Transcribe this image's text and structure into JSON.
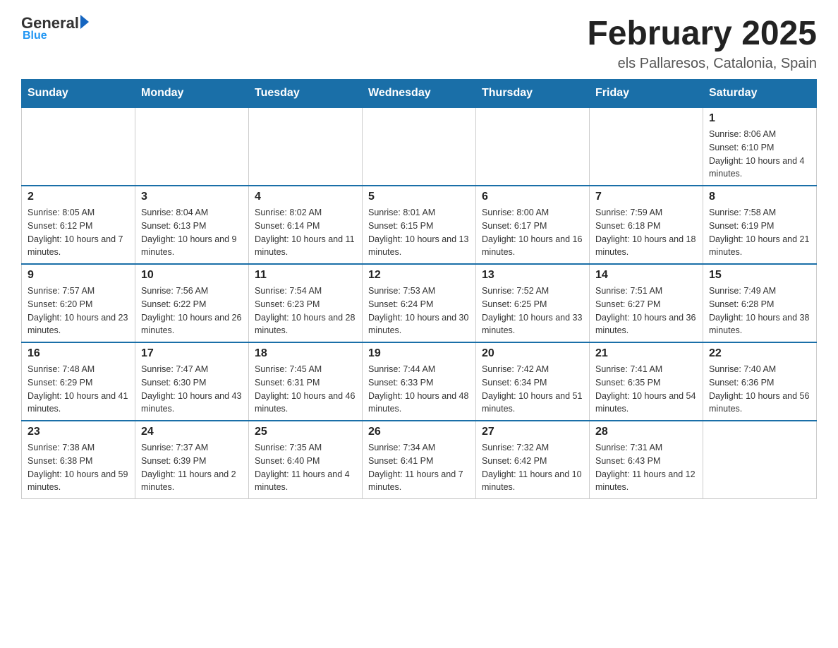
{
  "logo": {
    "text": "General",
    "blue_text": "Blue"
  },
  "title": "February 2025",
  "subtitle": "els Pallaresos, Catalonia, Spain",
  "weekdays": [
    "Sunday",
    "Monday",
    "Tuesday",
    "Wednesday",
    "Thursday",
    "Friday",
    "Saturday"
  ],
  "weeks": [
    [
      {
        "day": "",
        "info": ""
      },
      {
        "day": "",
        "info": ""
      },
      {
        "day": "",
        "info": ""
      },
      {
        "day": "",
        "info": ""
      },
      {
        "day": "",
        "info": ""
      },
      {
        "day": "",
        "info": ""
      },
      {
        "day": "1",
        "info": "Sunrise: 8:06 AM\nSunset: 6:10 PM\nDaylight: 10 hours and 4 minutes."
      }
    ],
    [
      {
        "day": "2",
        "info": "Sunrise: 8:05 AM\nSunset: 6:12 PM\nDaylight: 10 hours and 7 minutes."
      },
      {
        "day": "3",
        "info": "Sunrise: 8:04 AM\nSunset: 6:13 PM\nDaylight: 10 hours and 9 minutes."
      },
      {
        "day": "4",
        "info": "Sunrise: 8:02 AM\nSunset: 6:14 PM\nDaylight: 10 hours and 11 minutes."
      },
      {
        "day": "5",
        "info": "Sunrise: 8:01 AM\nSunset: 6:15 PM\nDaylight: 10 hours and 13 minutes."
      },
      {
        "day": "6",
        "info": "Sunrise: 8:00 AM\nSunset: 6:17 PM\nDaylight: 10 hours and 16 minutes."
      },
      {
        "day": "7",
        "info": "Sunrise: 7:59 AM\nSunset: 6:18 PM\nDaylight: 10 hours and 18 minutes."
      },
      {
        "day": "8",
        "info": "Sunrise: 7:58 AM\nSunset: 6:19 PM\nDaylight: 10 hours and 21 minutes."
      }
    ],
    [
      {
        "day": "9",
        "info": "Sunrise: 7:57 AM\nSunset: 6:20 PM\nDaylight: 10 hours and 23 minutes."
      },
      {
        "day": "10",
        "info": "Sunrise: 7:56 AM\nSunset: 6:22 PM\nDaylight: 10 hours and 26 minutes."
      },
      {
        "day": "11",
        "info": "Sunrise: 7:54 AM\nSunset: 6:23 PM\nDaylight: 10 hours and 28 minutes."
      },
      {
        "day": "12",
        "info": "Sunrise: 7:53 AM\nSunset: 6:24 PM\nDaylight: 10 hours and 30 minutes."
      },
      {
        "day": "13",
        "info": "Sunrise: 7:52 AM\nSunset: 6:25 PM\nDaylight: 10 hours and 33 minutes."
      },
      {
        "day": "14",
        "info": "Sunrise: 7:51 AM\nSunset: 6:27 PM\nDaylight: 10 hours and 36 minutes."
      },
      {
        "day": "15",
        "info": "Sunrise: 7:49 AM\nSunset: 6:28 PM\nDaylight: 10 hours and 38 minutes."
      }
    ],
    [
      {
        "day": "16",
        "info": "Sunrise: 7:48 AM\nSunset: 6:29 PM\nDaylight: 10 hours and 41 minutes."
      },
      {
        "day": "17",
        "info": "Sunrise: 7:47 AM\nSunset: 6:30 PM\nDaylight: 10 hours and 43 minutes."
      },
      {
        "day": "18",
        "info": "Sunrise: 7:45 AM\nSunset: 6:31 PM\nDaylight: 10 hours and 46 minutes."
      },
      {
        "day": "19",
        "info": "Sunrise: 7:44 AM\nSunset: 6:33 PM\nDaylight: 10 hours and 48 minutes."
      },
      {
        "day": "20",
        "info": "Sunrise: 7:42 AM\nSunset: 6:34 PM\nDaylight: 10 hours and 51 minutes."
      },
      {
        "day": "21",
        "info": "Sunrise: 7:41 AM\nSunset: 6:35 PM\nDaylight: 10 hours and 54 minutes."
      },
      {
        "day": "22",
        "info": "Sunrise: 7:40 AM\nSunset: 6:36 PM\nDaylight: 10 hours and 56 minutes."
      }
    ],
    [
      {
        "day": "23",
        "info": "Sunrise: 7:38 AM\nSunset: 6:38 PM\nDaylight: 10 hours and 59 minutes."
      },
      {
        "day": "24",
        "info": "Sunrise: 7:37 AM\nSunset: 6:39 PM\nDaylight: 11 hours and 2 minutes."
      },
      {
        "day": "25",
        "info": "Sunrise: 7:35 AM\nSunset: 6:40 PM\nDaylight: 11 hours and 4 minutes."
      },
      {
        "day": "26",
        "info": "Sunrise: 7:34 AM\nSunset: 6:41 PM\nDaylight: 11 hours and 7 minutes."
      },
      {
        "day": "27",
        "info": "Sunrise: 7:32 AM\nSunset: 6:42 PM\nDaylight: 11 hours and 10 minutes."
      },
      {
        "day": "28",
        "info": "Sunrise: 7:31 AM\nSunset: 6:43 PM\nDaylight: 11 hours and 12 minutes."
      },
      {
        "day": "",
        "info": ""
      }
    ]
  ]
}
